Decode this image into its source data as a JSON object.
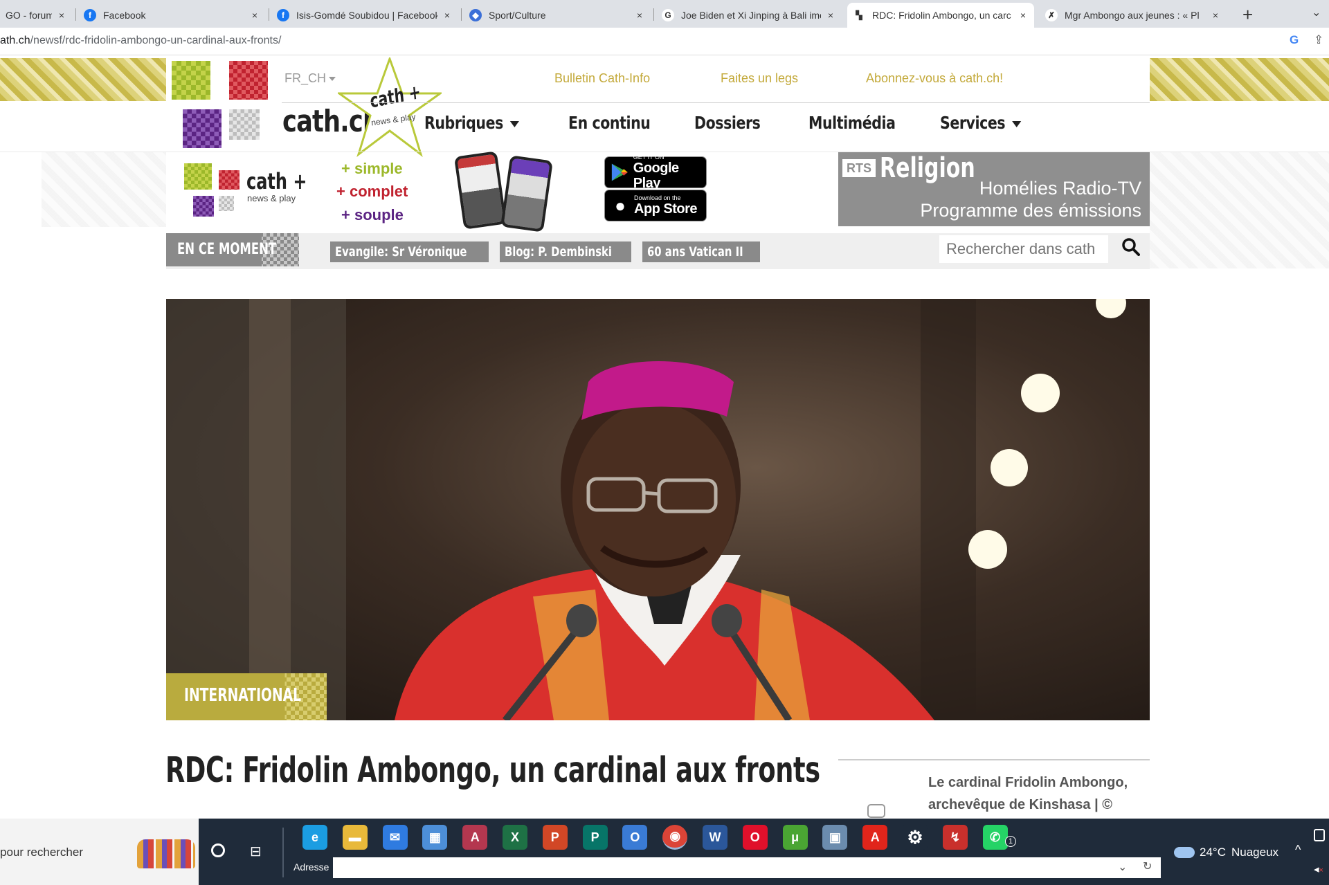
{
  "browser": {
    "tabs": [
      {
        "title": "GO - forumd",
        "icon": "forum-icon",
        "color": "#777777"
      },
      {
        "title": "Facebook",
        "icon": "facebook-icon",
        "color": "#1877f2"
      },
      {
        "title": "Isis-Gomdé Soubidou | Facebook",
        "icon": "facebook-icon",
        "color": "#1877f2"
      },
      {
        "title": "Sport/Culture",
        "icon": "shield-icon",
        "color": "#3b6fd8"
      },
      {
        "title": "Joe Biden et Xi Jinping à Bali ime",
        "icon": "google-icon",
        "color": "#ffffff"
      },
      {
        "title": "RDC: Fridolin Ambongo, un carc",
        "icon": "cath-icon",
        "color": "#ffffff"
      },
      {
        "title": "Mgr Ambongo aux jeunes : « Pl",
        "icon": "x-icon",
        "color": "#ffffff"
      }
    ],
    "close_glyph": "×",
    "new_tab_glyph": "+",
    "url_host": "ath.ch",
    "url_path": "/newsf/rdc-fridolin-ambongo-un-cardinal-aux-fronts/"
  },
  "site": {
    "lang": "FR_CH",
    "logo_text": "cath.ch",
    "star_title": "cath +",
    "star_sub": "news & play",
    "top_links": [
      "Bulletin Cath-Info",
      "Faites un legs",
      "Abonnez-vous à cath.ch!"
    ],
    "nav": [
      {
        "label": "Rubriques",
        "dropdown": true
      },
      {
        "label": "En continu",
        "dropdown": false
      },
      {
        "label": "Dossiers",
        "dropdown": false
      },
      {
        "label": "Multimédia",
        "dropdown": false
      },
      {
        "label": "Services",
        "dropdown": true
      }
    ],
    "promo": {
      "brand": "cath +",
      "brand_sub": "news & play",
      "lines": [
        "+ simple",
        "+ complet",
        "+ souple"
      ],
      "google_small": "GET IT ON",
      "google_big": "Google Play",
      "apple_small": "Download on the",
      "apple_big": "App Store"
    },
    "rts": {
      "badge": "RTS",
      "title": "Religion",
      "line1": "Homélies Radio-TV",
      "line2": "Programme des émissions"
    },
    "moment_label": "EN CE MOMENT",
    "moment_tags": [
      "Evangile: Sr Véronique",
      "Blog: P. Dembinski",
      "60 ans Vatican II"
    ],
    "search_placeholder": "Rechercher dans cath",
    "article": {
      "category": "INTERNATIONAL",
      "title": "RDC: Fridolin Ambongo, un cardinal aux fronts",
      "caption": "Le cardinal Fridolin Ambongo, archevêque de Kinshasa | ©"
    }
  },
  "taskbar": {
    "search_text": "pour rechercher",
    "address_label": "Adresse",
    "weather_temp": "24°C",
    "weather_desc": "Nuageux",
    "whatsapp_badge": "1",
    "apps": [
      {
        "name": "edge-icon",
        "glyph": "e",
        "color": "#1b9de2"
      },
      {
        "name": "file-explorer-icon",
        "glyph": "▬",
        "color": "#e8b93a"
      },
      {
        "name": "mail-icon",
        "glyph": "✉",
        "color": "#2f7be0"
      },
      {
        "name": "store-icon",
        "glyph": "▦",
        "color": "#4d8fd8"
      },
      {
        "name": "access-icon",
        "glyph": "A",
        "color": "#b4374f"
      },
      {
        "name": "excel-icon",
        "glyph": "X",
        "color": "#1e7145"
      },
      {
        "name": "powerpoint-icon",
        "glyph": "P",
        "color": "#d24726"
      },
      {
        "name": "publisher-icon",
        "glyph": "P",
        "color": "#077568"
      },
      {
        "name": "outlook-icon",
        "glyph": "O",
        "color": "#3a7bd5"
      },
      {
        "name": "chrome-icon",
        "glyph": "◉",
        "color": "#db4437"
      },
      {
        "name": "word-icon",
        "glyph": "W",
        "color": "#2b579a"
      },
      {
        "name": "opera-icon",
        "glyph": "O",
        "color": "#e0102b"
      },
      {
        "name": "utorrent-icon",
        "glyph": "μ",
        "color": "#4aa533"
      },
      {
        "name": "photos-icon",
        "glyph": "▣",
        "color": "#6b8cae"
      },
      {
        "name": "acrobat-icon",
        "glyph": "A",
        "color": "#e1251b"
      },
      {
        "name": "settings-icon",
        "glyph": "⚙",
        "color": "#1f2b3a"
      },
      {
        "name": "graph-app-icon",
        "glyph": "↯",
        "color": "#c9302c"
      },
      {
        "name": "whatsapp-icon",
        "glyph": "✆",
        "color": "#25d366"
      }
    ]
  }
}
